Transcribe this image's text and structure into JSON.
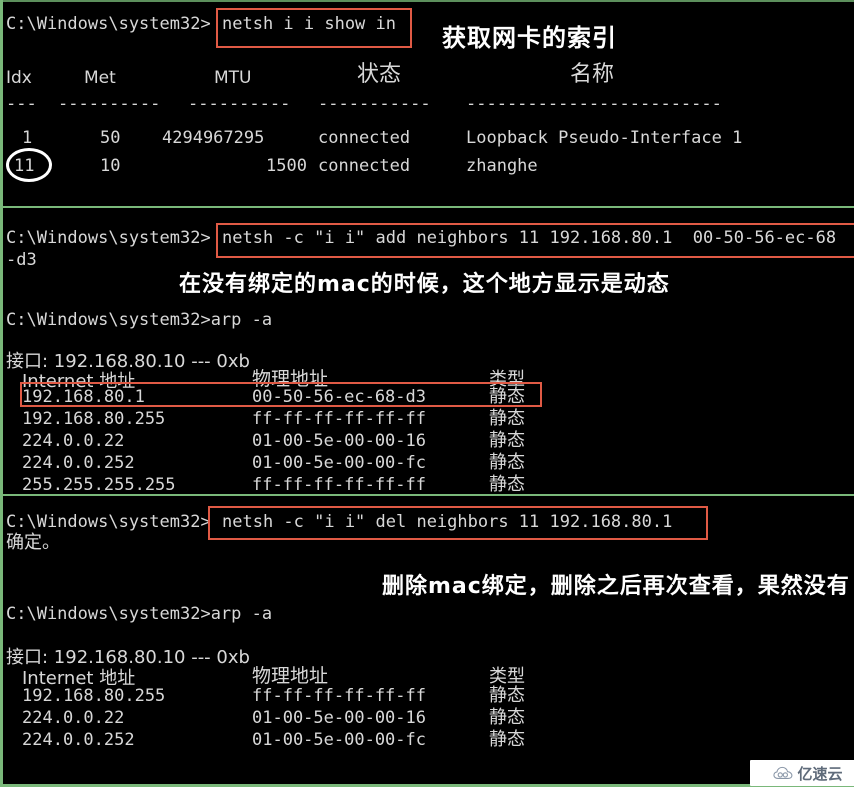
{
  "window": {
    "title": "Windows Command Prompt - ARP / netsh static MAC binding tutorial",
    "prompt": "C:\\Windows\\system32>"
  },
  "section1": {
    "command_line": "C:\\Windows\\system32>",
    "command": "netsh i i show in",
    "annotation": "获取网卡的索引",
    "table": {
      "headers": [
        "Idx",
        "Met",
        "MTU",
        "状态",
        "名称"
      ],
      "separator_row": [
        "---",
        "----------",
        "----------",
        "-----------",
        "-------------------------"
      ],
      "rows": [
        {
          "idx": "1",
          "met": "50",
          "mtu": "4294967295",
          "state": "connected",
          "name": "Loopback Pseudo-Interface 1"
        },
        {
          "idx": "11",
          "met": "10",
          "mtu": "1500",
          "state": "connected",
          "name": "zhanghe"
        }
      ]
    },
    "circled_value": "11"
  },
  "section2": {
    "command_line": "C:\\Windows\\system32>",
    "command": "netsh -c \"i i\" add neighbors 11 192.168.80.1  00-50-56-ec-68",
    "command_wrap": "-d3",
    "annotation": "在没有绑定的mac的时候，这个地方显示是动态",
    "arp_command_line": "C:\\Windows\\system32>arp -a",
    "interface_line": "接口: 192.168.80.10 --- 0xb",
    "table": {
      "headers": [
        "Internet 地址",
        "物理地址",
        "类型"
      ],
      "rows": [
        {
          "ip": "192.168.80.1",
          "mac": "00-50-56-ec-68-d3",
          "type": "静态",
          "highlighted": true
        },
        {
          "ip": "192.168.80.255",
          "mac": "ff-ff-ff-ff-ff-ff",
          "type": "静态",
          "highlighted": false
        },
        {
          "ip": "224.0.0.22",
          "mac": "01-00-5e-00-00-16",
          "type": "静态",
          "highlighted": false
        },
        {
          "ip": "224.0.0.252",
          "mac": "01-00-5e-00-00-fc",
          "type": "静态",
          "highlighted": false
        },
        {
          "ip": "255.255.255.255",
          "mac": "ff-ff-ff-ff-ff-ff",
          "type": "静态",
          "highlighted": false
        }
      ]
    }
  },
  "section3": {
    "command_line": "C:\\Windows\\system32>",
    "command": "netsh -c \"i i\" del neighbors 11 192.168.80.1",
    "result": "确定。",
    "annotation": "删除mac绑定，删除之后再次查看，果然没有",
    "arp_command_line": "C:\\Windows\\system32>arp -a",
    "interface_line": "接口: 192.168.80.10 --- 0xb",
    "table": {
      "headers": [
        "Internet 地址",
        "物理地址",
        "类型"
      ],
      "rows": [
        {
          "ip": "192.168.80.255",
          "mac": "ff-ff-ff-ff-ff-ff",
          "type": "静态"
        },
        {
          "ip": "224.0.0.22",
          "mac": "01-00-5e-00-00-16",
          "type": "静态"
        },
        {
          "ip": "224.0.0.252",
          "mac": "01-00-5e-00-00-fc",
          "type": "静态"
        }
      ]
    }
  },
  "watermark": {
    "text": "亿速云",
    "icon": "cloud-icon"
  },
  "colors": {
    "terminal_background": "#000000",
    "terminal_text": "#d8d8d8",
    "annotation_text": "#ffffff",
    "highlight_box": "#e05a45",
    "panel_border": "#7ab87a",
    "watermark_background": "#ffffff",
    "watermark_text": "#5f6b7a"
  }
}
